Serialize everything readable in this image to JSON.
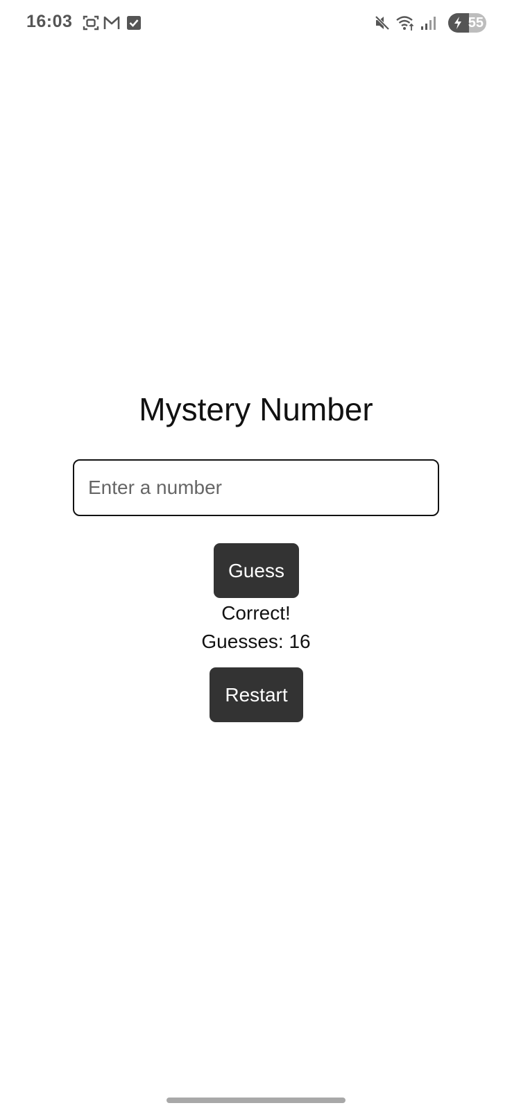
{
  "status_bar": {
    "time": "16:03",
    "icons": [
      "screenshot-icon",
      "gmail-icon",
      "checkbox-icon",
      "mute-icon",
      "wifi-icon",
      "signal-icon"
    ],
    "battery_level": "55",
    "battery_fraction": 0.55,
    "charging": true
  },
  "app": {
    "title": "Mystery Number",
    "input": {
      "placeholder": "Enter a number",
      "value": ""
    },
    "guess_label": "Guess",
    "result_message": "Correct!",
    "guess_count": "Guesses: 16",
    "restart_label": "Restart"
  },
  "colors": {
    "button_bg": "#333333",
    "button_text": "#ffffff",
    "text": "#111111",
    "background": "#ffffff"
  }
}
